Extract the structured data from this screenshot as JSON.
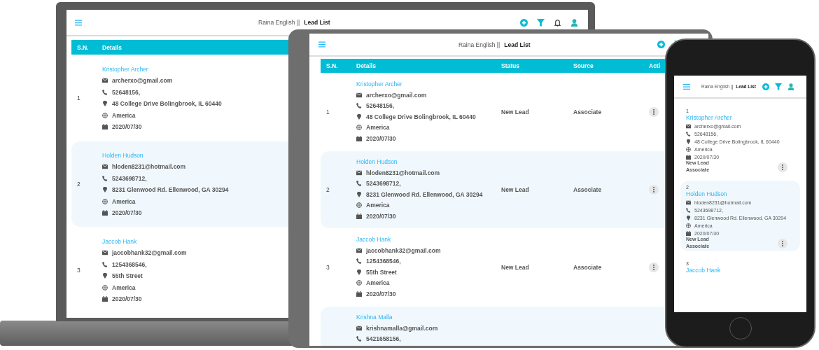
{
  "laptop": {
    "header": {
      "user": "Raina English ||",
      "title": "Lead List"
    },
    "columns": [
      "S.N.",
      "Details"
    ],
    "rows": [
      {
        "sn": "1",
        "name": "Kristopher Archer",
        "email": "archerxo@gmail.com",
        "phone": "52648156,",
        "address": "48 College Drive Bolingbrook, IL 60440",
        "country": "America",
        "date": "2020/07/30"
      },
      {
        "sn": "2",
        "name": "Holden Hudson",
        "email": "hloden8231@hotmail.com",
        "phone": "5243698712,",
        "address": "8231 Glenwood Rd. Ellenwood, GA 30294",
        "country": "America",
        "date": "2020/07/30"
      },
      {
        "sn": "3",
        "name": "Jaccob Hank",
        "email": "jaccobhank32@gmail.com",
        "phone": "1254368546,",
        "address": "55th Street",
        "country": "America",
        "date": "2020/07/30"
      }
    ]
  },
  "tablet": {
    "header": {
      "user": "Raina English ||",
      "title": "Lead List"
    },
    "columns": [
      "S.N.",
      "Details",
      "Status",
      "Source",
      "Acti"
    ],
    "rows": [
      {
        "sn": "1",
        "name": "Kristopher Archer",
        "email": "archerxo@gmail.com",
        "phone": "52648156,",
        "address": "48 College Drive Bolingbrook, IL 60440",
        "country": "America",
        "date": "2020/07/30",
        "status": "New Lead",
        "source": "Associate"
      },
      {
        "sn": "2",
        "name": "Holden Hudson",
        "email": "hloden8231@hotmail.com",
        "phone": "5243698712,",
        "address": "8231 Glenwood Rd. Ellenwood, GA 30294",
        "country": "America",
        "date": "2020/07/30",
        "status": "New Lead",
        "source": "Associate"
      },
      {
        "sn": "3",
        "name": "Jaccob Hank",
        "email": "jaccobhank32@gmail.com",
        "phone": "1254368546,",
        "address": "55th Street",
        "country": "America",
        "date": "2020/07/30",
        "status": "New Lead",
        "source": "Associate"
      },
      {
        "name": "Krishna Malla",
        "email": "krishnamalla@gmail.com",
        "phone": "5421658156,"
      }
    ]
  },
  "phone": {
    "header": {
      "user": "Raina English ||",
      "title": "Lead List"
    },
    "cards": [
      {
        "sn": "1",
        "name": "Kristopher Archer",
        "email": "archerxo@gmail.com",
        "phone": "52648156,",
        "address": "48 College Drive Bolingbrook, IL 60440",
        "country": "America",
        "date": "2020/07/30",
        "status": "New Lead",
        "source": "Associate"
      },
      {
        "sn": "2",
        "name": "Holden Hudson",
        "email": "hloden8231@hotmail.com",
        "phone": "5243698712,",
        "address": "8231 Glenwood Rd. Ellenwood, GA 30294",
        "country": "America",
        "date": "2020/07/30",
        "status": "New Lead",
        "source": "Associate"
      },
      {
        "sn": "3",
        "name": "Jaccob Hank"
      }
    ]
  }
}
